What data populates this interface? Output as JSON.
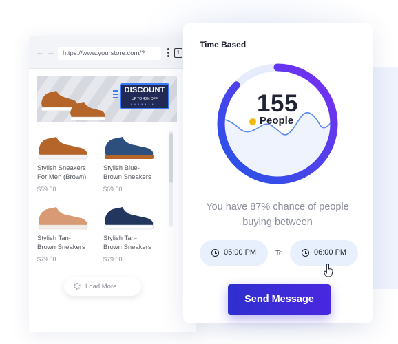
{
  "browser": {
    "url": "https://www.yourstore.com/?",
    "tab_count": "1",
    "back_icon": "arrow-left-icon",
    "forward_icon": "arrow-right-icon",
    "menu_icon": "kebab-menu-icon"
  },
  "banner": {
    "badge_title": "DISCOUNT",
    "badge_subtitle": "UP TO 40% OFF",
    "badge_dots": "• • • • • • •"
  },
  "products": [
    {
      "name_line1": "Stylish Sneakers",
      "name_line2": "For Men (Brown)",
      "price": "$59.00",
      "color": "#b5652a",
      "sole": "#f3f3f3"
    },
    {
      "name_line1": "Stylish Blue-",
      "name_line2": "Brown Sneakers",
      "price": "$69.00",
      "color": "#2d4f7e",
      "sole": "#b5652a"
    },
    {
      "name_line1": "Stylish Tan-",
      "name_line2": "Brown Sneakers",
      "price": "$79.00",
      "color": "#d89a74",
      "sole": "#f3ede8"
    },
    {
      "name_line1": "Stylish Tan-",
      "name_line2": "Brown Sneakers",
      "price": "$79.00",
      "color": "#23365e",
      "sole": "#ffffff"
    }
  ],
  "load_more": {
    "label": "Load More"
  },
  "card": {
    "title": "Time Based",
    "count": "155",
    "count_unit": "People",
    "gauge_fill": 0.87,
    "description": "You have 87% chance of people buying between",
    "start_time": "05:00 PM",
    "separator": "To",
    "end_time": "06:00 PM",
    "clock_icon": "clock-icon",
    "cursor_icon": "hand-pointer-icon",
    "button_label": "Send Message"
  },
  "colors": {
    "accent": "#3a2fe0",
    "gauge_start": "#2456e6",
    "gauge_end": "#7a2cf2",
    "pill_bg": "#e9f0fd",
    "dot": "#f5b90e"
  }
}
